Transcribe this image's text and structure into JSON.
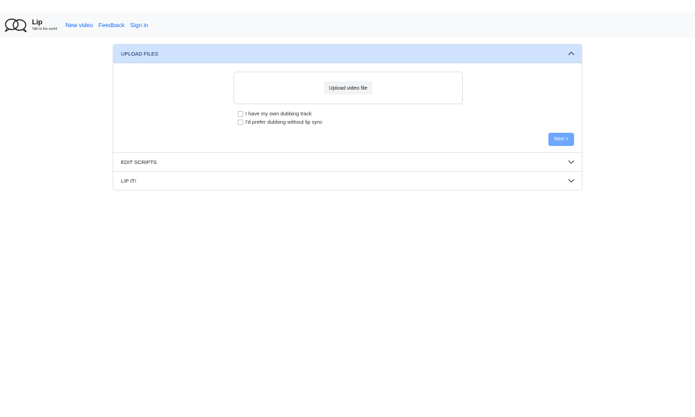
{
  "brand": {
    "name": "Lip",
    "tagline": "Talk to the world"
  },
  "nav": {
    "links": [
      "New video",
      "Feedback",
      "Sign in"
    ]
  },
  "accordion": {
    "sections": [
      {
        "title": "UPLOAD FILES",
        "expanded": true
      },
      {
        "title": "EDIT SCRIPTS",
        "expanded": false
      },
      {
        "title": "LIP IT!",
        "expanded": false
      }
    ],
    "upload": {
      "button_label": "Upload video file",
      "options": [
        {
          "label": "I have my own dubbing track",
          "checked": false
        },
        {
          "label": "I'd prefer dubbing without lip sync",
          "checked": false
        }
      ],
      "next_label": "Next >"
    }
  },
  "colors": {
    "link": "#0d6efd",
    "active_header_bg": "#cfe2ff",
    "next_button_bg": "#6ea8fe",
    "navbar_bg": "#f8f9fa"
  },
  "icons": {
    "logo": "two-speech-bubbles-logo",
    "expanded": "chevron-up-icon",
    "collapsed": "chevron-down-icon"
  }
}
